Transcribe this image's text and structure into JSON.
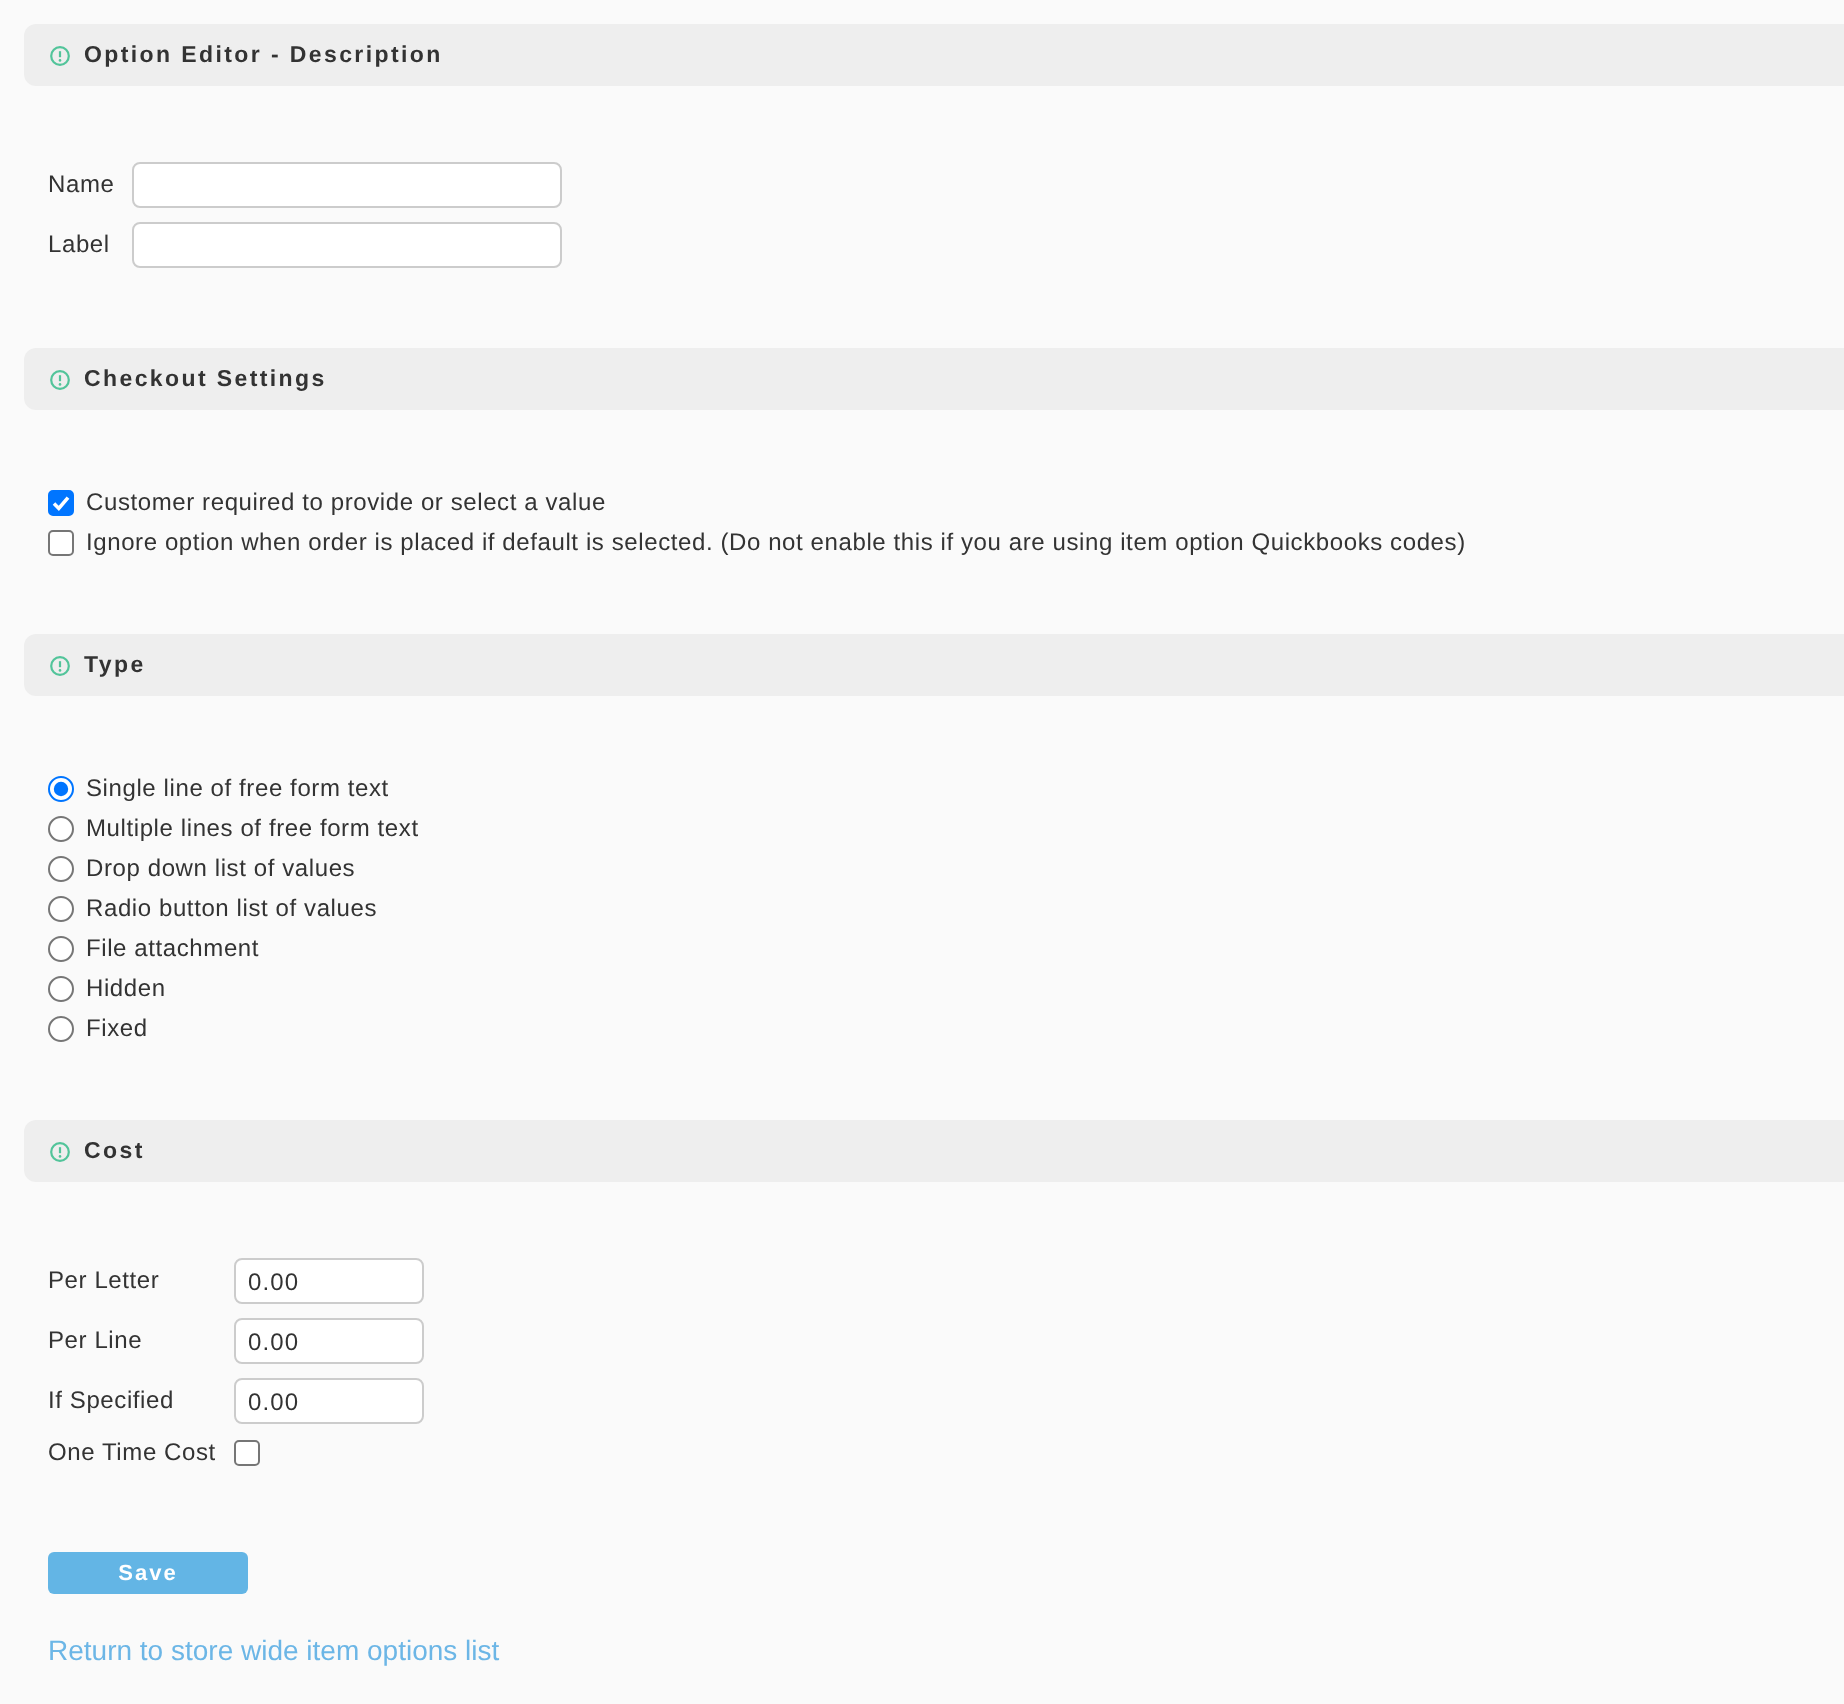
{
  "sections": [
    {
      "title": "Option Editor - Description",
      "items": [
        {
          "kind": "input",
          "label": "Name"
        },
        {
          "kind": "input",
          "label": "Label"
        }
      ]
    },
    {
      "title": "Checkout Settings",
      "items": [
        {
          "kind": "checkbox",
          "label": "Customer required to provide or select a value",
          "checked": true
        },
        {
          "kind": "checkbox",
          "label": "Ignore option when order is placed if default is selected. (Do not enable this if you are using item option Quickbooks codes)",
          "checked": false
        }
      ]
    },
    {
      "title": "Type",
      "items": [
        {
          "kind": "radio",
          "label": "Single line of free form text",
          "selected": true
        },
        {
          "kind": "radio",
          "label": "Multiple lines of free form text",
          "selected": false
        },
        {
          "kind": "radio",
          "label": "Drop down list of values",
          "selected": false
        },
        {
          "kind": "radio",
          "label": "Radio button list of values",
          "selected": false
        },
        {
          "kind": "radio",
          "label": "File attachment",
          "selected": false
        },
        {
          "kind": "radio",
          "label": "Hidden",
          "selected": false
        },
        {
          "kind": "radio",
          "label": "Fixed",
          "selected": false
        }
      ]
    },
    {
      "title": "Cost",
      "items": [
        {
          "kind": "input",
          "label": "Per Letter",
          "value": "0.00"
        },
        {
          "kind": "input",
          "label": "Per Line",
          "value": "0.00"
        },
        {
          "kind": "input",
          "label": "If Specified",
          "value": "0.00"
        },
        {
          "kind": "labeled-checkbox",
          "label": "One Time Cost",
          "checked": false
        }
      ]
    }
  ],
  "save_button": "Save",
  "link": "Return to store wide item options list"
}
